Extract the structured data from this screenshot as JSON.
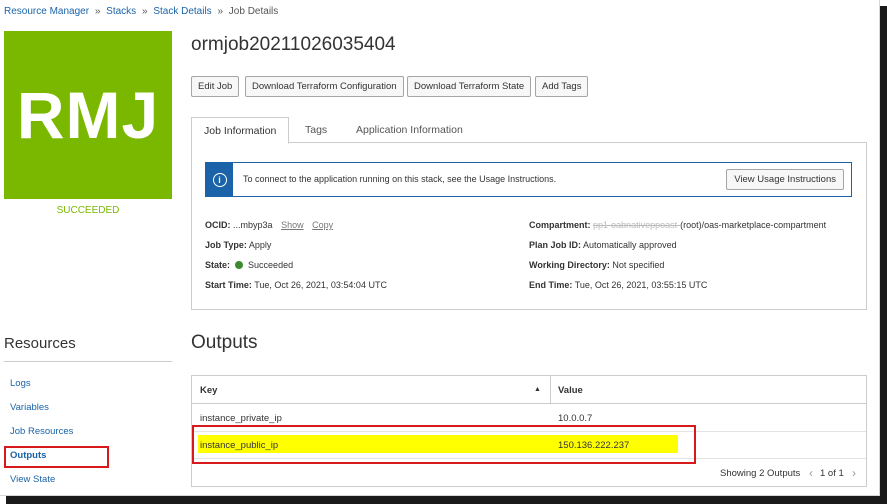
{
  "breadcrumb": {
    "items": [
      "Resource Manager",
      "Stacks",
      "Stack Details"
    ],
    "current": "Job Details",
    "separator": "»"
  },
  "logo": {
    "text": "RMJ",
    "color": "#7ab800"
  },
  "job": {
    "status": "SUCCEEDED",
    "title": "ormjob20211026035404"
  },
  "toolbar": {
    "edit_label": "Edit Job",
    "download_config_label": "Download Terraform Configuration",
    "download_state_label": "Download Terraform State",
    "add_tags_label": "Add Tags"
  },
  "tabs": [
    {
      "label": "Job Information",
      "active": true
    },
    {
      "label": "Tags",
      "active": false
    },
    {
      "label": "Application Information",
      "active": false
    }
  ],
  "alert": {
    "icon": "info-icon",
    "text": "To connect to the application running on this stack, see the Usage Instructions.",
    "button_label": "View Usage Instructions"
  },
  "details": {
    "ocid_label": "OCID:",
    "ocid_value": "...mbyp3a",
    "show_label": "Show",
    "copy_label": "Copy",
    "job_type_label": "Job Type:",
    "job_type_value": "Apply",
    "state_label": "State:",
    "state_value": "Succeeded",
    "start_label": "Start Time:",
    "start_value": "Tue, Oct 26, 2021, 03:54:04 UTC",
    "compartment_label": "Compartment:",
    "compartment_redacted": "pp1-oabnativeppoast-",
    "compartment_value": "(root)/oas-marketplace-compartment",
    "plan_label": "Plan Job ID:",
    "plan_value": "Automatically approved",
    "workdir_label": "Working Directory:",
    "workdir_value": "Not specified",
    "end_label": "End Time:",
    "end_value": "Tue, Oct 26, 2021, 03:55:15 UTC"
  },
  "resources": {
    "title": "Resources",
    "items": [
      "Logs",
      "Variables",
      "Job Resources",
      "Outputs",
      "View State"
    ],
    "active": "Outputs"
  },
  "outputs": {
    "title": "Outputs",
    "columns": [
      "Key",
      "Value"
    ],
    "rows": [
      {
        "key": "instance_private_ip",
        "value": "10.0.0.7"
      },
      {
        "key": "instance_public_ip",
        "value": "150.136.222.237"
      }
    ],
    "summary": "Showing 2 Outputs",
    "page": "1 of 1"
  },
  "colors": {
    "link": "#1a63a8",
    "success": "#7ab800",
    "highlight": "#ffff00",
    "annotation": "#d7191c"
  }
}
